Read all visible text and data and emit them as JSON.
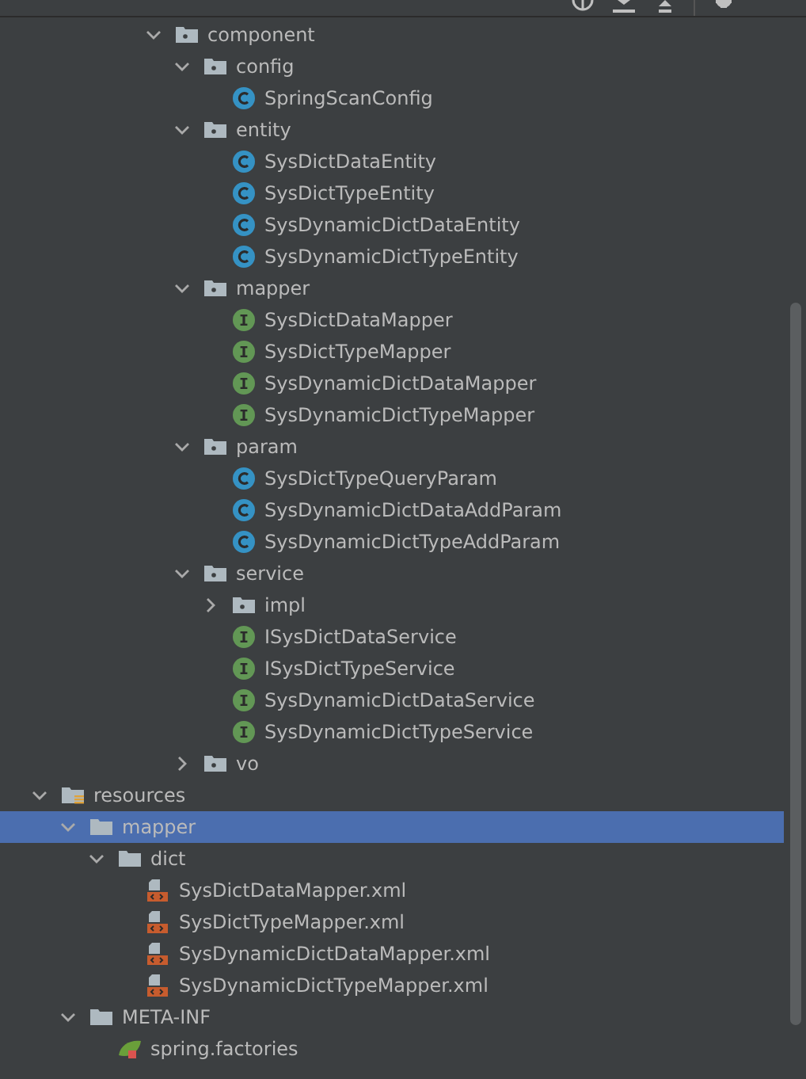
{
  "tree": [
    {
      "children": [
        {
          "children": [
            {
              "children": [
                {
                  "children": [
                    {
                      "children": [
                        {
                          "label": "component",
                          "kind": "package",
                          "expanded": true,
                          "selected": false,
                          "children": [
                            {
                              "label": "config",
                              "kind": "package",
                              "expanded": true,
                              "selected": false,
                              "children": [
                                {
                                  "label": "SpringScanConfig",
                                  "kind": "class",
                                  "selected": false
                                }
                              ]
                            },
                            {
                              "label": "entity",
                              "kind": "package",
                              "expanded": true,
                              "selected": false,
                              "children": [
                                {
                                  "label": "SysDictDataEntity",
                                  "kind": "class",
                                  "selected": false
                                },
                                {
                                  "label": "SysDictTypeEntity",
                                  "kind": "class",
                                  "selected": false
                                },
                                {
                                  "label": "SysDynamicDictDataEntity",
                                  "kind": "class",
                                  "selected": false
                                },
                                {
                                  "label": "SysDynamicDictTypeEntity",
                                  "kind": "class",
                                  "selected": false
                                }
                              ]
                            },
                            {
                              "label": "mapper",
                              "kind": "package",
                              "expanded": true,
                              "selected": false,
                              "children": [
                                {
                                  "label": "SysDictDataMapper",
                                  "kind": "interface",
                                  "selected": false
                                },
                                {
                                  "label": "SysDictTypeMapper",
                                  "kind": "interface",
                                  "selected": false
                                },
                                {
                                  "label": "SysDynamicDictDataMapper",
                                  "kind": "interface",
                                  "selected": false
                                },
                                {
                                  "label": "SysDynamicDictTypeMapper",
                                  "kind": "interface",
                                  "selected": false
                                }
                              ]
                            },
                            {
                              "label": "param",
                              "kind": "package",
                              "expanded": true,
                              "selected": false,
                              "children": [
                                {
                                  "label": "SysDictTypeQueryParam",
                                  "kind": "class",
                                  "selected": false
                                },
                                {
                                  "label": "SysDynamicDictDataAddParam",
                                  "kind": "class",
                                  "selected": false
                                },
                                {
                                  "label": "SysDynamicDictTypeAddParam",
                                  "kind": "class",
                                  "selected": false
                                }
                              ]
                            },
                            {
                              "label": "service",
                              "kind": "package",
                              "expanded": true,
                              "selected": false,
                              "children": [
                                {
                                  "label": "impl",
                                  "kind": "package",
                                  "expanded": false,
                                  "selected": false
                                },
                                {
                                  "label": "ISysDictDataService",
                                  "kind": "interface",
                                  "selected": false
                                },
                                {
                                  "label": "ISysDictTypeService",
                                  "kind": "interface",
                                  "selected": false
                                },
                                {
                                  "label": "SysDynamicDictDataService",
                                  "kind": "interface",
                                  "selected": false
                                },
                                {
                                  "label": "SysDynamicDictTypeService",
                                  "kind": "interface",
                                  "selected": false
                                }
                              ]
                            },
                            {
                              "label": "vo",
                              "kind": "package",
                              "expanded": false,
                              "selected": false
                            }
                          ]
                        }
                      ]
                    }
                  ]
                }
              ]
            }
          ]
        },
        {
          "label": "resources",
          "kind": "resources",
          "expanded": true,
          "selected": false,
          "children": [
            {
              "label": "mapper",
              "kind": "folder",
              "expanded": true,
              "selected": true,
              "children": [
                {
                  "label": "dict",
                  "kind": "folder",
                  "expanded": true,
                  "selected": false,
                  "children": [
                    {
                      "label": "SysDictDataMapper.xml",
                      "kind": "xml",
                      "selected": false
                    },
                    {
                      "label": "SysDictTypeMapper.xml",
                      "kind": "xml",
                      "selected": false
                    },
                    {
                      "label": "SysDynamicDictDataMapper.xml",
                      "kind": "xml",
                      "selected": false
                    },
                    {
                      "label": "SysDynamicDictTypeMapper.xml",
                      "kind": "xml",
                      "selected": false
                    }
                  ]
                }
              ]
            },
            {
              "label": "META-INF",
              "kind": "folder",
              "expanded": true,
              "selected": false,
              "children": [
                {
                  "label": "spring.factories",
                  "kind": "spring",
                  "selected": false
                }
              ]
            }
          ]
        }
      ]
    }
  ]
}
